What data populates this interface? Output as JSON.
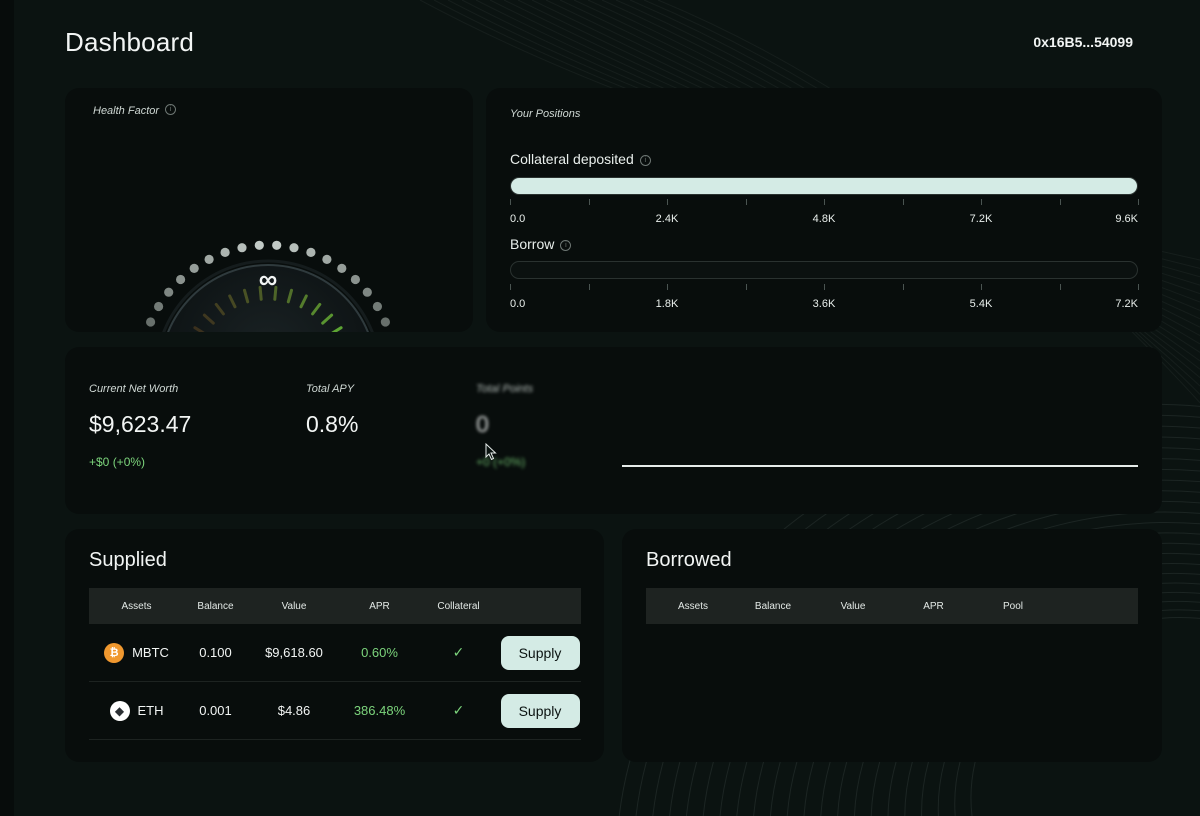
{
  "header": {
    "title": "Dashboard",
    "wallet": "0x16B5...54099"
  },
  "health": {
    "label": "Health Factor",
    "value": "∞",
    "info_icon": "info-icon"
  },
  "positions": {
    "label": "Your Positions",
    "collateral": {
      "title": "Collateral deposited",
      "fill_fraction": 1.0,
      "ticks": [
        "0.0",
        "2.4K",
        "4.8K",
        "7.2K",
        "9.6K"
      ]
    },
    "borrow": {
      "title": "Borrow",
      "fill_fraction": 0.0,
      "ticks": [
        "0.0",
        "1.8K",
        "3.6K",
        "5.4K",
        "7.2K"
      ]
    }
  },
  "stats": {
    "net_worth": {
      "label": "Current Net Worth",
      "value": "$9,623.47",
      "change": "+$0 (+0%)"
    },
    "apy": {
      "label": "Total APY",
      "value": "0.8%"
    },
    "points": {
      "label": "Total Points",
      "value": "0",
      "change": "+0 (+0%)"
    }
  },
  "supplied": {
    "title": "Supplied",
    "columns": [
      "Assets",
      "Balance",
      "Value",
      "APR",
      "Collateral",
      ""
    ],
    "rows": [
      {
        "asset": "MBTC",
        "icon": "bitcoin-icon",
        "balance": "0.100",
        "value": "$9,618.60",
        "apr": "0.60%",
        "collateral": "✓",
        "action": "Supply"
      },
      {
        "asset": "ETH",
        "icon": "ethereum-icon",
        "balance": "0.001",
        "value": "$4.86",
        "apr": "386.48%",
        "collateral": "✓",
        "action": "Supply"
      }
    ]
  },
  "borrowed": {
    "title": "Borrowed",
    "columns": [
      "Assets",
      "Balance",
      "Value",
      "APR",
      "Pool"
    ]
  },
  "colors": {
    "accent": "#d4ebe5",
    "positive": "#7cd47c",
    "background": "#0b1311",
    "card": "#080d0c"
  }
}
